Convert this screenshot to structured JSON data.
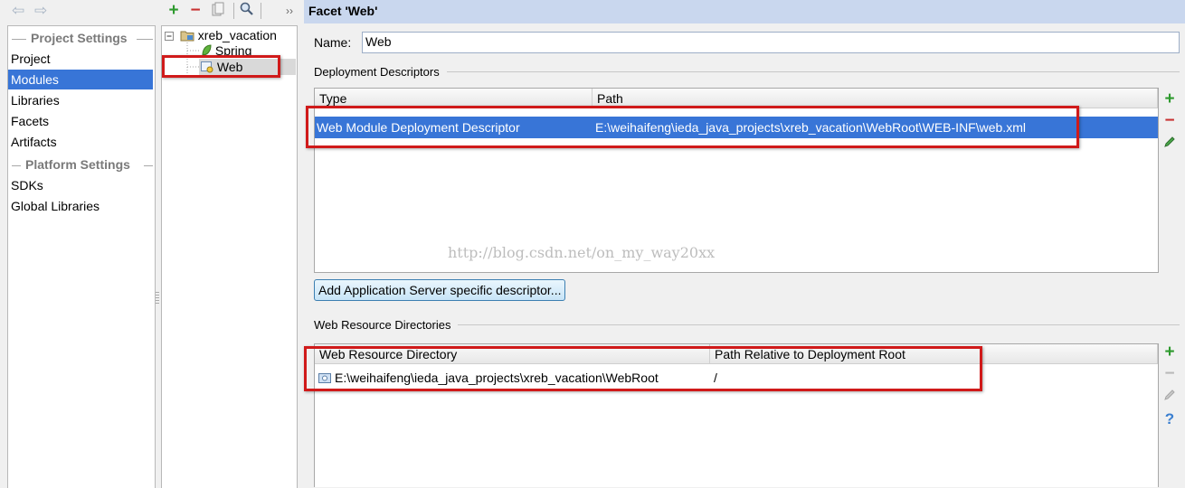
{
  "nav": {
    "back_icon": "arrow-left-icon",
    "forward_icon": "arrow-right-icon"
  },
  "sidebar": {
    "groups": [
      {
        "title": "Project Settings",
        "items": [
          "Project",
          "Modules",
          "Libraries",
          "Facets",
          "Artifacts"
        ]
      },
      {
        "title": "Platform Settings",
        "items": [
          "SDKs",
          "Global Libraries"
        ]
      }
    ],
    "selected": "Modules"
  },
  "toolbar": {
    "icons": [
      "add-icon",
      "remove-icon",
      "copy-icon",
      "search-icon",
      "more-icon"
    ],
    "more_label": "››"
  },
  "tree": {
    "root": "xreb_vacation",
    "children": [
      "Spring",
      "Web"
    ],
    "selected": "Web"
  },
  "facet": {
    "title": "Facet 'Web'",
    "name_label": "Name:",
    "name_value": "Web"
  },
  "deployment": {
    "section_title": "Deployment Descriptors",
    "columns": [
      "Type",
      "Path"
    ],
    "rows": [
      {
        "type": "Web Module Deployment Descriptor",
        "path": "E:\\weihaifeng\\ieda_java_projects\\xreb_vacation\\WebRoot\\WEB-INF\\web.xml"
      }
    ],
    "add_server_button": "Add Application Server specific descriptor..."
  },
  "resources": {
    "section_title": "Web Resource Directories",
    "columns": [
      "Web Resource Directory",
      "Path Relative to Deployment Root"
    ],
    "rows": [
      {
        "directory": "E:\\weihaifeng\\ieda_java_projects\\xreb_vacation\\WebRoot",
        "relative": "/"
      }
    ]
  },
  "watermark": "http://blog.csdn.net/on_my_way20xx",
  "colors": {
    "selection": "#3875d7",
    "header": "#c9d7ee",
    "add": "#2e9a2e",
    "remove": "#c83232",
    "highlight_box": "#d01a1a"
  }
}
